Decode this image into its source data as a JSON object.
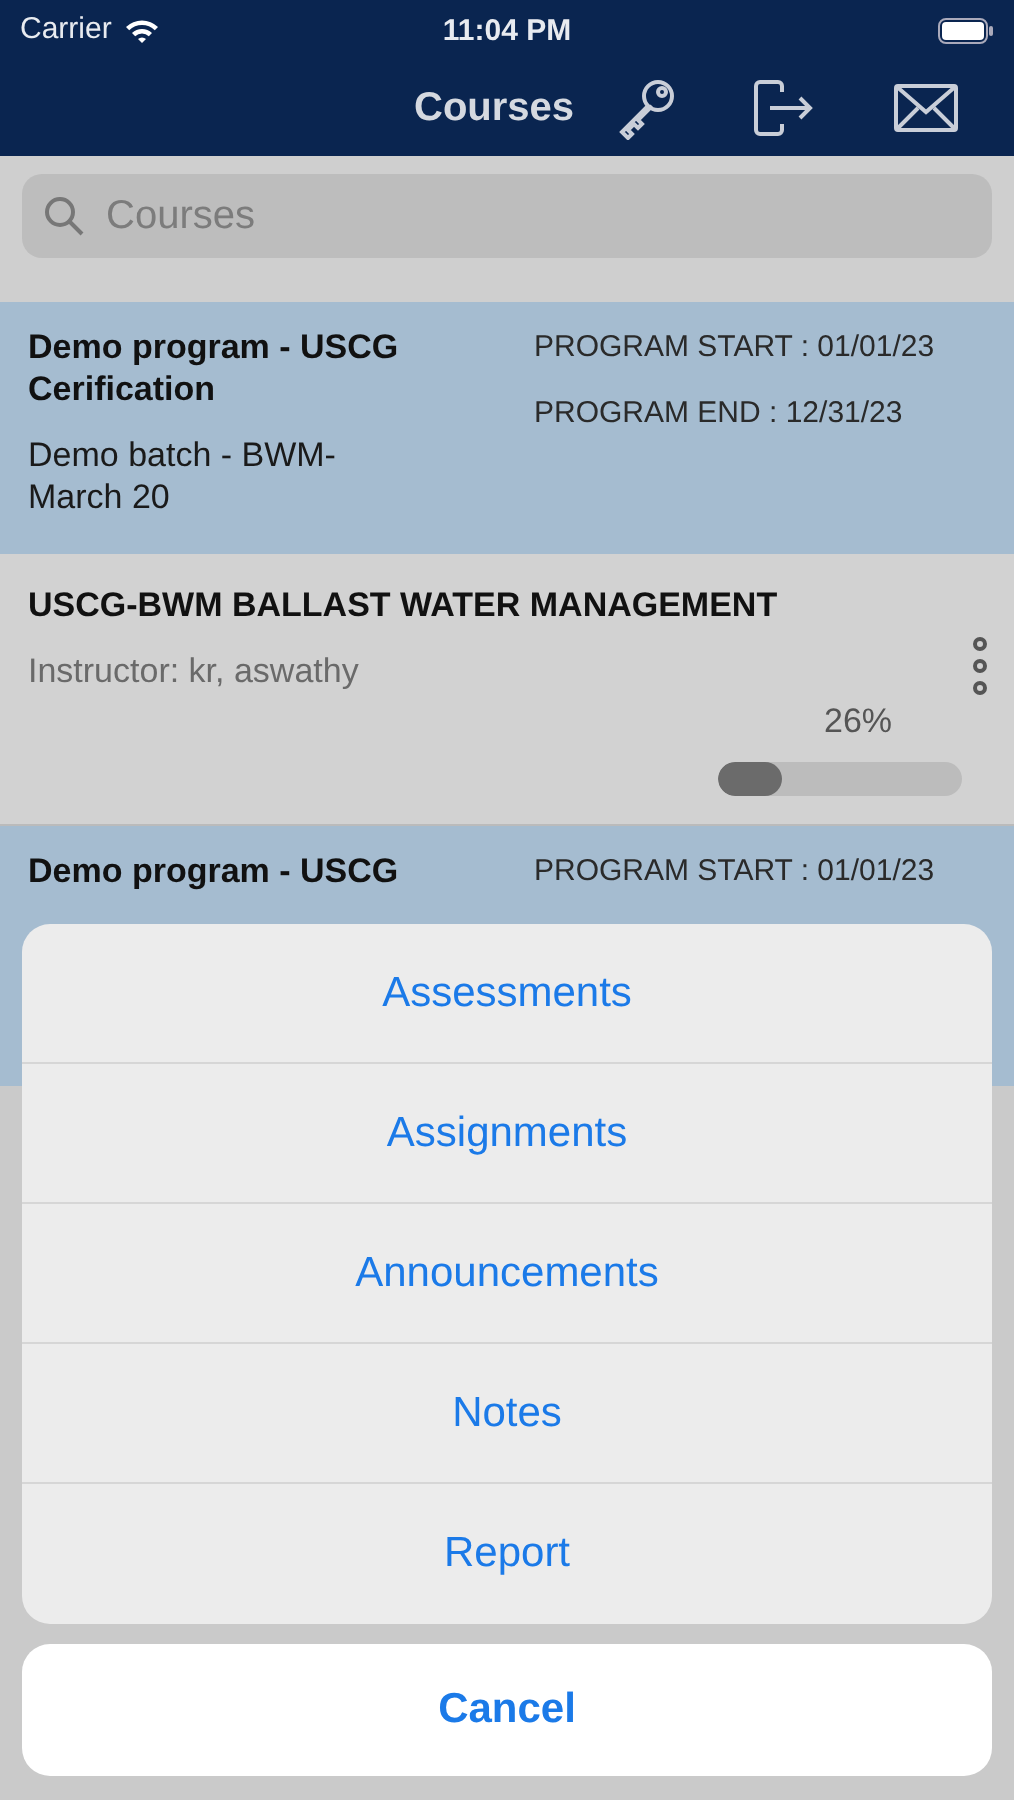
{
  "status_bar": {
    "carrier": "Carrier",
    "time": "11:04 PM"
  },
  "nav": {
    "title": "Courses"
  },
  "search": {
    "placeholder": "Courses"
  },
  "list": [
    {
      "kind": "program",
      "title": "Demo program - USCG Cerification",
      "batch": "Demo batch - BWM-March 20",
      "start": "PROGRAM START : 01/01/23",
      "end": "PROGRAM END : 12/31/23"
    },
    {
      "kind": "course",
      "title": "USCG-BWM BALLAST WATER MANAGEMENT",
      "instructor": "Instructor: kr, aswathy",
      "progress": "26%",
      "level": 0.26
    },
    {
      "kind": "program",
      "title": "Demo program - USCG",
      "start": "PROGRAM START : 01/01/23"
    }
  ],
  "action_sheet": {
    "actions": [
      "Assessments",
      "Assignments",
      "Announcements",
      "Notes",
      "Report"
    ],
    "cancel": "Cancel"
  }
}
